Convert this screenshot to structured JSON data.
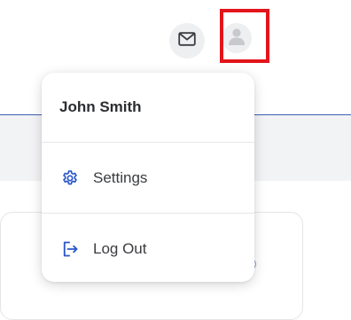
{
  "header": {
    "mail_icon": "envelope-icon",
    "avatar_icon": "user-avatar-icon",
    "highlight_color": "#e3141b"
  },
  "user_menu": {
    "user_name": "John Smith",
    "items": [
      {
        "label": "Settings",
        "icon": "gear-icon"
      },
      {
        "label": "Log Out",
        "icon": "logout-icon"
      }
    ],
    "accent_color": "#2b56c9"
  }
}
